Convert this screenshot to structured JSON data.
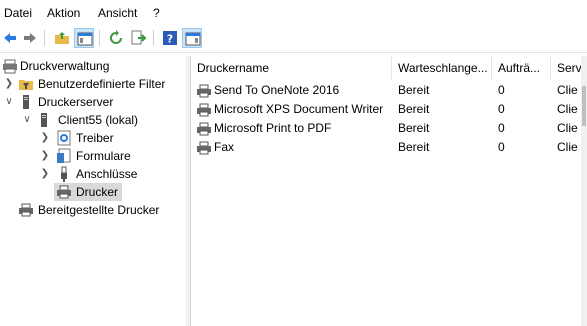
{
  "menu": [
    "Datei",
    "Aktion",
    "Ansicht",
    "?"
  ],
  "toolbar": {
    "icons": [
      "back-arrow-icon",
      "forward-arrow-icon",
      "up-folder-icon",
      "show-hide-tree-icon",
      "refresh-icon",
      "export-list-icon",
      "help-icon",
      "show-hide-action-pane-icon"
    ]
  },
  "tree": {
    "root": "Druckverwaltung",
    "filters": "Benutzerdefinierte Filter",
    "servers": "Druckerserver",
    "client": "Client55 (lokal)",
    "treiber": "Treiber",
    "formulare": "Formulare",
    "anschluesse": "Anschlüsse",
    "drucker": "Drucker",
    "deployed": "Bereitgestellte Drucker"
  },
  "list": {
    "columns": [
      "Druckername",
      "Warteschlange...",
      "Aufträ...",
      "Serv"
    ],
    "rows": [
      {
        "name": "Send To OneNote 2016",
        "status": "Bereit",
        "jobs": "0",
        "server": "Clie"
      },
      {
        "name": "Microsoft XPS Document Writer",
        "status": "Bereit",
        "jobs": "0",
        "server": "Clie"
      },
      {
        "name": "Microsoft Print to PDF",
        "status": "Bereit",
        "jobs": "0",
        "server": "Clie"
      },
      {
        "name": "Fax",
        "status": "Bereit",
        "jobs": "0",
        "server": "Clie"
      }
    ]
  },
  "colors": {
    "accent": "#2a7ae2",
    "selection": "#d9d9d9",
    "toolbar_active": "#cce4f7"
  }
}
